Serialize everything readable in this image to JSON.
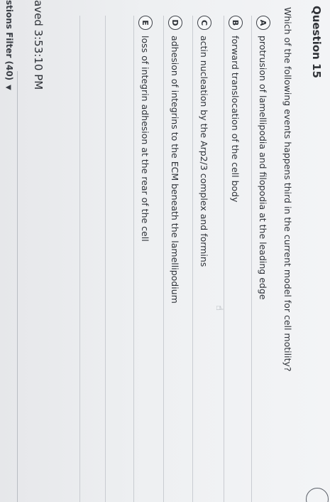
{
  "question": {
    "title": "Question 15",
    "prompt": "Which of the following events happens third in the current model for cell motility?",
    "options": [
      {
        "letter": "A",
        "text": "protrusion of lamellipodia and filopodia at the leading edge"
      },
      {
        "letter": "B",
        "text": "forward translocation of the cell body"
      },
      {
        "letter": "C",
        "text": "actin nucleation by the Arp2/3 complex and formins"
      },
      {
        "letter": "D",
        "text": "adhesion of integrins to the ECM beneath the lamellipodium"
      },
      {
        "letter": "E",
        "text": "loss of integrin adhesion at the rear of the cell"
      }
    ]
  },
  "footer": {
    "saved": "aved 3:53:10 PM",
    "filter": "stions Filter (40)"
  },
  "icons": {
    "thumb": "hand-pointer-icon"
  }
}
